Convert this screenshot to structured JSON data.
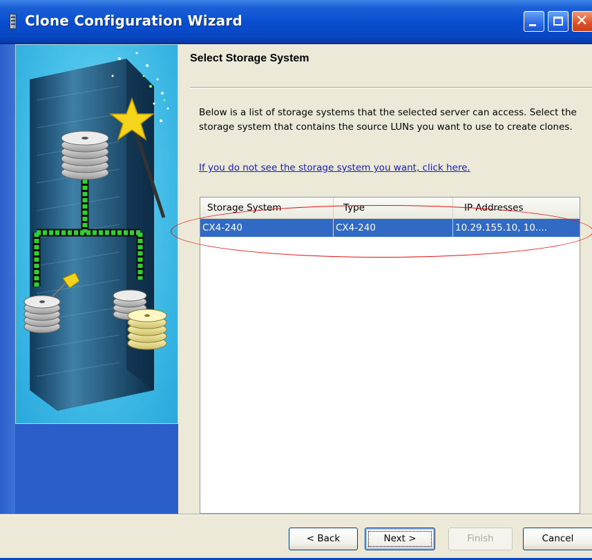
{
  "window": {
    "title": "Clone Configuration Wizard",
    "controls": {
      "minimize_icon": "minimize-icon",
      "maximize_icon": "maximize-icon",
      "close_icon": "close-icon"
    }
  },
  "colors": {
    "titlebar": "#0a4fd0",
    "selection": "#316ac5",
    "annotation": "#e01010",
    "link": "#1a1ab5",
    "dialog_bg": "#ece9d8"
  },
  "header": {
    "title": "Select Storage System"
  },
  "description": "Below is a list of storage systems that the selected server can access. Select the storage system that contains the source LUNs you want to use to create clones.",
  "help_link": "If you do not see the storage system you want, click here.",
  "table": {
    "columns": [
      "Storage System",
      "Type",
      "IP Addresses"
    ],
    "rows": [
      {
        "storage_system": "CX4-240",
        "type": "CX4-240",
        "ip_addresses": "10.29.155.10, 10...."
      }
    ],
    "selected_row": 0
  },
  "buttons": {
    "back": "< Back",
    "next": "Next >",
    "finish": "Finish",
    "cancel": "Cancel",
    "finish_enabled": false
  },
  "illustration": {
    "icon": "storage-tower-with-magic-wand-icon"
  }
}
